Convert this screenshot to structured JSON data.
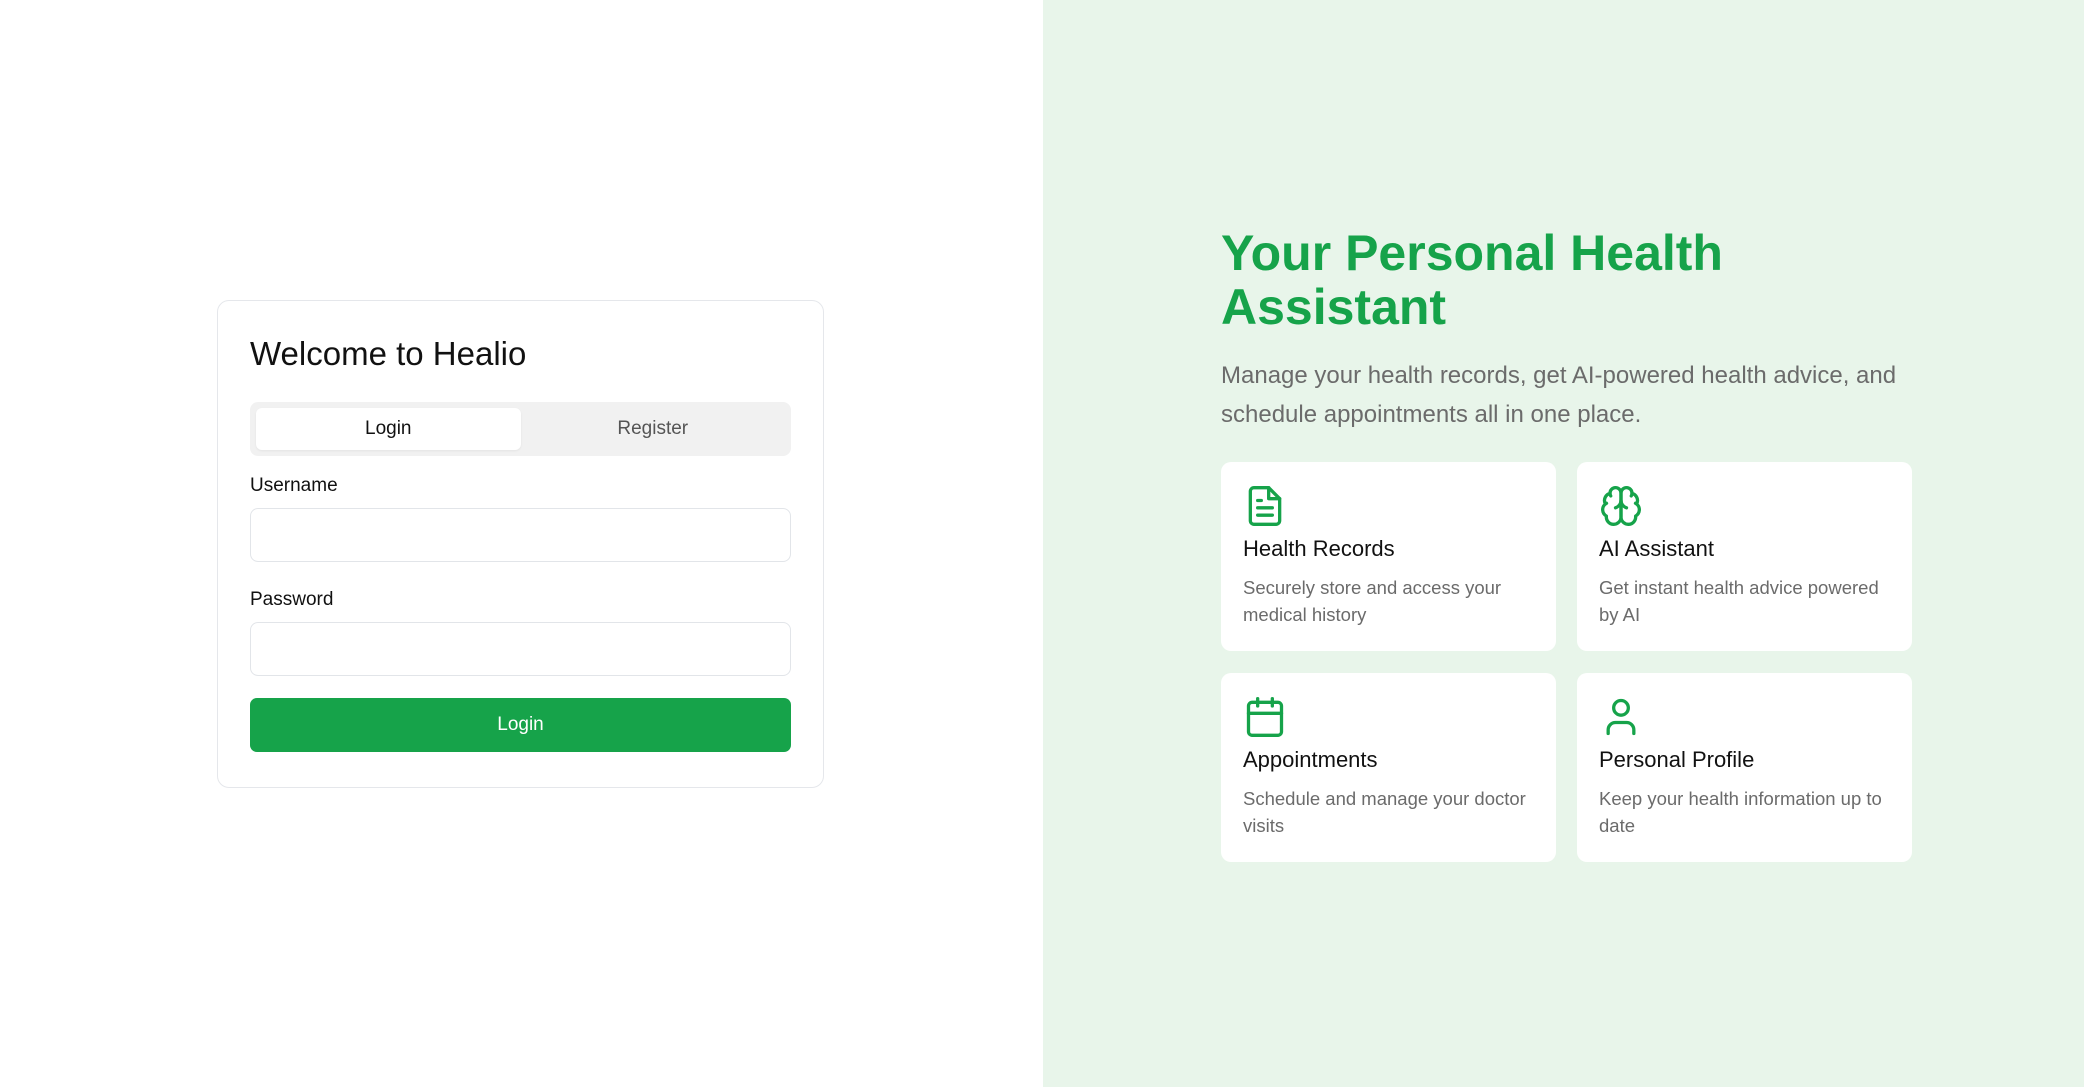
{
  "login_card": {
    "title": "Welcome to Healio",
    "tabs": [
      {
        "label": "Login",
        "active": true
      },
      {
        "label": "Register",
        "active": false
      }
    ],
    "username_label": "Username",
    "username_value": "",
    "password_label": "Password",
    "password_value": "",
    "submit_label": "Login"
  },
  "promo": {
    "title": "Your Personal Health Assistant",
    "description": "Manage your health records, get AI-powered health advice, and schedule appointments all in one place.",
    "features": [
      {
        "icon": "document-icon",
        "title": "Health Records",
        "description": "Securely store and access your medical history"
      },
      {
        "icon": "brain-icon",
        "title": "AI Assistant",
        "description": "Get instant health advice powered by AI"
      },
      {
        "icon": "calendar-icon",
        "title": "Appointments",
        "description": "Schedule and manage your doctor visits"
      },
      {
        "icon": "user-icon",
        "title": "Personal Profile",
        "description": "Keep your health information up to date"
      }
    ]
  },
  "colors": {
    "accent": "#16a34a",
    "promo_background": "#e8f5ea",
    "muted_text": "#6b6b6b"
  }
}
